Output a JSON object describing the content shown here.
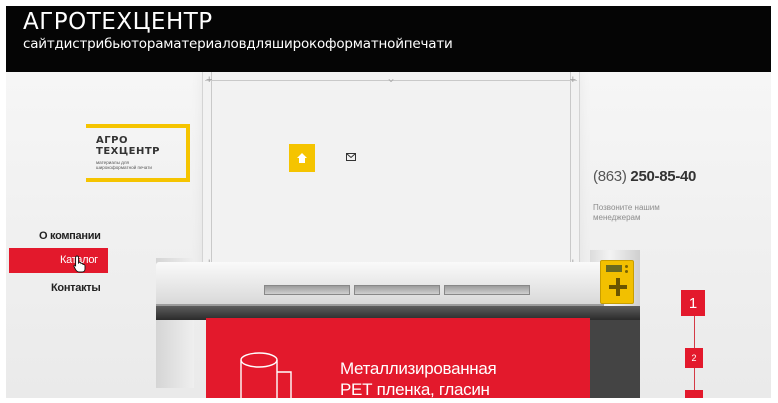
{
  "caption": {
    "title": "АГРОТЕХЦЕНТР",
    "subtitle": "сайтдистрибьютораматериаловдляширокоформатнойпечати"
  },
  "logo": {
    "line1": "АГРО",
    "line2": "ТЕХЦЕНТР",
    "tagline": "материалы для широкоформатной печати"
  },
  "nav": {
    "about": "О компании",
    "catalog": "Каталог",
    "contacts": "Контакты"
  },
  "contact": {
    "phone_code": "(863)",
    "phone_number": "250-85-40",
    "call_us": "Позвоните нашим менеджерам"
  },
  "banner": {
    "line1": "Металлизированная",
    "line2": "РЕТ пленка, гласин"
  },
  "pager": {
    "page1": "1",
    "page2": "2",
    "page3": ""
  },
  "colors": {
    "accent_red": "#e3192c",
    "accent_yellow": "#f5c400",
    "caption_bg": "#050505"
  },
  "icons": {
    "yellow_button": "home-icon",
    "small": "mail-icon",
    "cursor": "hand-cursor-icon"
  }
}
